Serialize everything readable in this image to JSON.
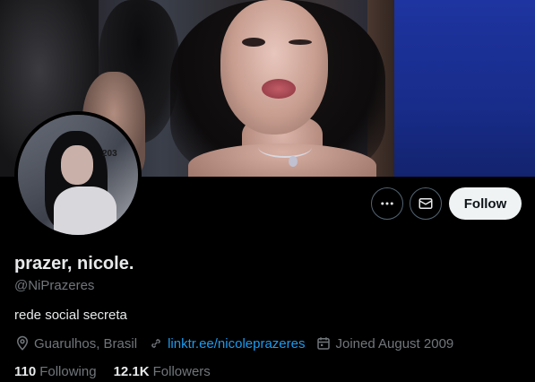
{
  "profile": {
    "display_name": "prazer, nicole.",
    "handle": "@NiPrazeres",
    "bio": "rede social secreta",
    "location": "Guarulhos, Brasil",
    "website": "linktr.ee/nicoleprazeres",
    "joined": "Joined August 2009",
    "avatar_overlay_text": "203"
  },
  "stats": {
    "following_count": "110",
    "following_label": "Following",
    "followers_count": "12.1K",
    "followers_label": "Followers"
  },
  "actions": {
    "more_icon": "more-horizontal-icon",
    "message_icon": "envelope-icon",
    "follow_label": "Follow"
  },
  "colors": {
    "background": "#000000",
    "primary_text": "#e7e9ea",
    "secondary_text": "#71767b",
    "link": "#1d9bf0",
    "follow_button_bg": "#eff3f4",
    "follow_button_text": "#0f1419"
  }
}
